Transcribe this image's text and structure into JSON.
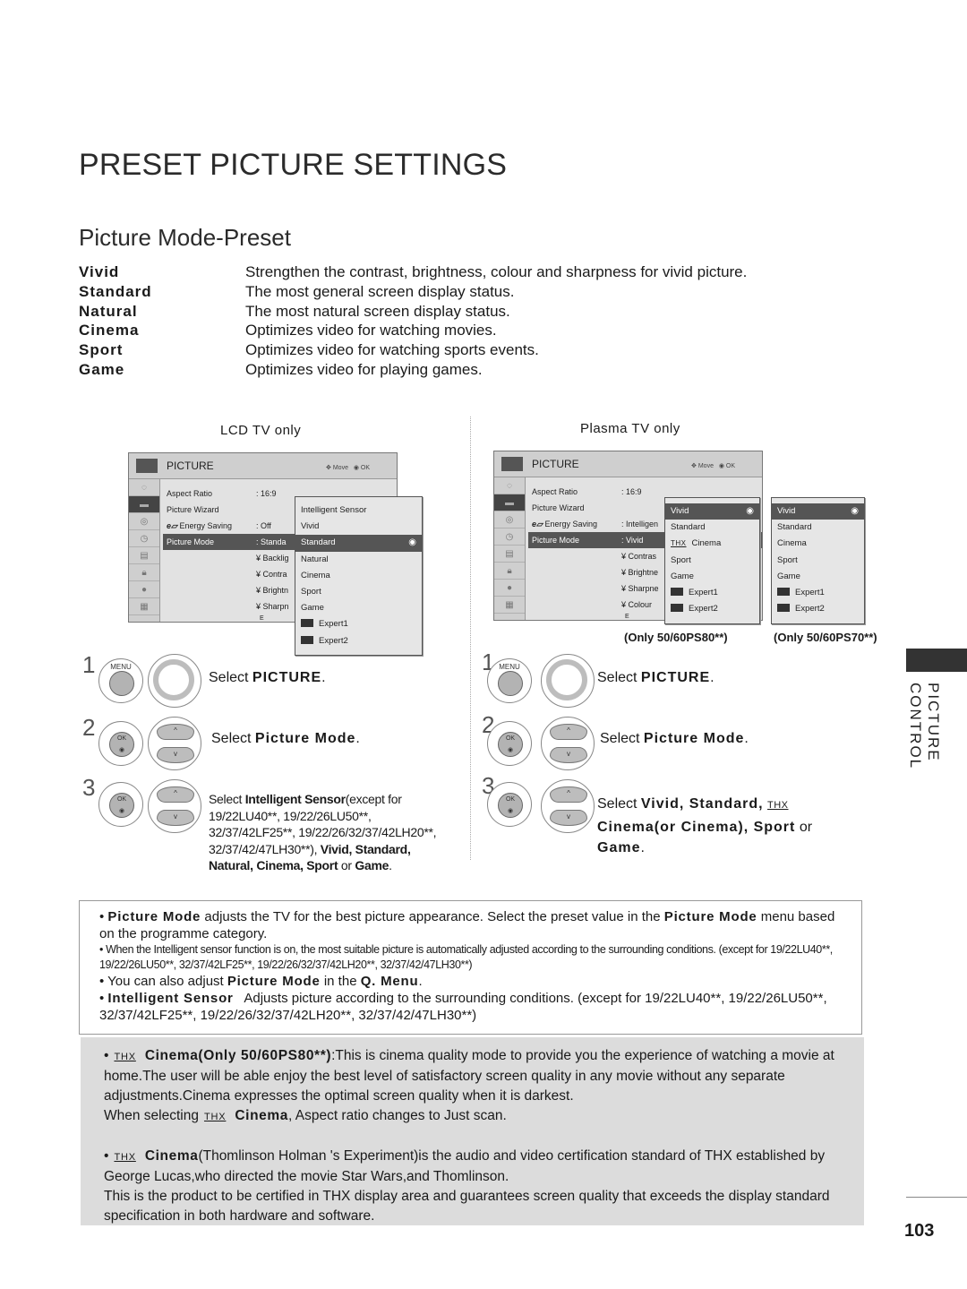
{
  "page": {
    "title": "PRESET PICTURE SETTINGS",
    "subtitle": "Picture Mode-Preset",
    "page_number": "103",
    "side_label": "PICTURE CONTROL"
  },
  "modes": [
    {
      "name": "Vivid",
      "desc": "Strengthen the contrast, brightness, colour and sharpness for vivid picture."
    },
    {
      "name": "Standard",
      "desc": "The most general screen display status."
    },
    {
      "name": "Natural",
      "desc": "The most natural screen display status."
    },
    {
      "name": "Cinema",
      "desc": "Optimizes video for watching movies."
    },
    {
      "name": "Sport",
      "desc": "Optimizes video for watching sports events."
    },
    {
      "name": "Game",
      "desc": "Optimizes video for playing games."
    }
  ],
  "lcd": {
    "label": "LCD TV only",
    "menu": {
      "title": "PICTURE",
      "hint_move": "Move",
      "hint_ok": "OK",
      "rows": [
        {
          "k": "Aspect Ratio",
          "v": ": 16:9"
        },
        {
          "k": "Picture Wizard",
          "v": ""
        },
        {
          "k": "Energy Saving",
          "v": ": Off"
        },
        {
          "k": "Picture Mode",
          "v": ": Standa"
        }
      ],
      "subs": [
        "¥ Backlig",
        "¥ Contra",
        "¥ Brightn",
        "¥ Sharpn",
        "E"
      ]
    },
    "popup": [
      "Intelligent Sensor",
      "Vivid",
      "Standard",
      "Natural",
      "Cinema",
      "Sport",
      "Game",
      "Expert1",
      "Expert2"
    ],
    "popup_selected": "Standard",
    "steps": {
      "s1": "Select",
      "s1b": "PICTURE",
      "s2": "Select",
      "s2b": "Picture Mode",
      "s3_pre": "Select",
      "s3_b1": "Intelligent Sensor",
      "s3_mid": "(except for 19/22LU40**, 19/22/26LU50**, 32/37/42LF25**, 19/22/26/32/37/42LH20**, 32/37/42/47LH30**),",
      "s3_b2": "Vivid, Standard, Natural, Cinema, Sport",
      "s3_or": "or",
      "s3_b3": "Game"
    }
  },
  "plasma": {
    "label": "Plasma TV only",
    "menu": {
      "title": "PICTURE",
      "hint_move": "Move",
      "hint_ok": "OK",
      "rows": [
        {
          "k": "Aspect Ratio",
          "v": ": 16:9"
        },
        {
          "k": "Picture Wizard",
          "v": ""
        },
        {
          "k": "Energy Saving",
          "v": ": Intelligen"
        },
        {
          "k": "Picture Mode",
          "v": ": Vivid"
        }
      ],
      "subs": [
        "¥ Contras",
        "¥ Brightne",
        "¥ Sharpne",
        "¥ Colour",
        "E"
      ]
    },
    "popup_ps80": [
      "Vivid",
      "Standard",
      "Cinema",
      "Sport",
      "Game",
      "Expert1",
      "Expert2"
    ],
    "popup_ps70": [
      "Vivid",
      "Standard",
      "Cinema",
      "Sport",
      "Game",
      "Expert1",
      "Expert2"
    ],
    "caption_ps80": "(Only 50/60PS80**)",
    "caption_ps70": "(Only 50/60PS70**)",
    "steps": {
      "s1": "Select",
      "s1b": "PICTURE",
      "s2": "Select",
      "s2b": "Picture Mode",
      "s3_pre": "Select",
      "s3_b1": "Vivid, Standard,",
      "s3_b2": "Cinema(or Cinema), Sport",
      "s3_or": "or",
      "s3_b3": "Game"
    }
  },
  "buttons": {
    "menu": "MENU",
    "ok": "OK",
    "thx": "THX"
  },
  "step_numbers": [
    "1",
    "2",
    "3"
  ],
  "notes": {
    "n1_b1": "Picture Mode",
    "n1_t1": "adjusts the TV for the best picture appearance. Select the preset value in the",
    "n1_b2": "Picture Mode",
    "n1_t2": "menu based on the programme category.",
    "n2": "When the Intelligent sensor function is on, the most suitable picture is automatically adjusted according to the surrounding conditions. (except for 19/22LU40**, 19/22/26LU50**, 32/37/42LF25**, 19/22/26/32/37/42LH20**, 32/37/42/47LH30**)",
    "n3_t1": "You can also adjust",
    "n3_b1": "Picture Mode",
    "n3_t2": "in the",
    "n3_b2": "Q. Menu",
    "n4_b": "Intelligent Sensor",
    "n4_t": "Adjusts picture according to the surrounding conditions. (except for 19/22LU40**, 19/22/26LU50**, 32/37/42LF25**, 19/22/26/32/37/42LH20**, 32/37/42/47LH30**)"
  },
  "thx_notes": {
    "p1_b": "Cinema(Only 50/60PS80**)",
    "p1_t": ":This is cinema quality mode to provide you the experience of watching a movie at home.The user will be able enjoy the best level of satisfactory screen quality in any movie without any separate adjustments.Cinema expresses the optimal screen quality when it is darkest.",
    "p1_t2": "When selecting",
    "p1_b2": "Cinema",
    "p1_t3": ", Aspect ratio changes to Just scan.",
    "p2_b": "Cinema",
    "p2_t": "(Thomlinson Holman 's Experiment)is the audio and video certification standard of THX established by George Lucas,who directed the movie Star Wars,and Thomlinson.",
    "p2_t2": "This is the product to be certified in THX display area and guarantees screen quality that exceeds the display standard specification in both hardware and software."
  }
}
